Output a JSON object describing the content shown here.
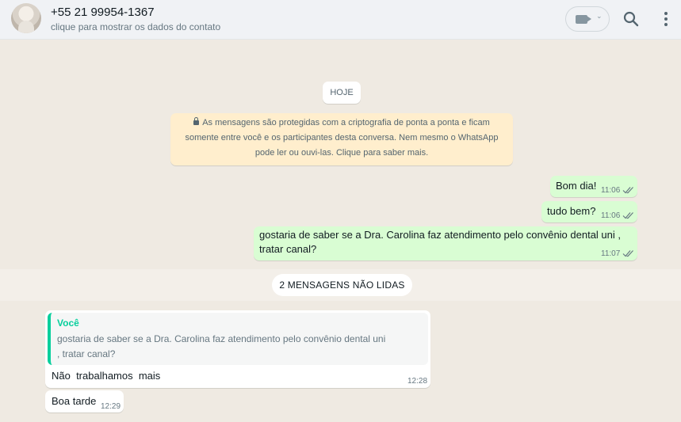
{
  "header": {
    "contact_phone": "+55 21 99954-1367",
    "contact_subtitle": "clique para mostrar os dados do contato",
    "icons": [
      "avatar",
      "video-call-icon",
      "chevron-down-icon",
      "search-icon",
      "menu-icon"
    ]
  },
  "chat": {
    "date_label": "HOJE",
    "encryption_notice": "As mensagens são protegidas com a criptografia de ponta a ponta e ficam somente entre você e os participantes desta conversa. Nem mesmo o WhatsApp pode ler ou ouvi-las. Clique para saber mais.",
    "encryption_lines": [
      "As mensagens são protegidas com a criptografia de ponta a ponta e ficam",
      "somente entre você e os participantes desta conversa. Nem mesmo o WhatsApp",
      "pode ler ou ouvi-las. Clique para saber mais."
    ],
    "outgoing": [
      {
        "text": "Bom dia!",
        "time": "11:06",
        "status": "delivered"
      },
      {
        "text": "tudo bem?",
        "time": "11:06",
        "status": "delivered"
      },
      {
        "text_lines": [
          "gostaria de saber se a Dra. Carolina faz atendimento pelo convênio dental uni ,",
          "tratar canal?"
        ],
        "time": "11:07",
        "status": "delivered"
      }
    ],
    "unread_label": "2 MENSAGENS NÃO LIDAS",
    "incoming": [
      {
        "quote_author": "Você",
        "quote_lines": [
          "gostaria de saber se a Dra. Carolina faz atendimento pelo convênio dental uni",
          ", tratar canal?"
        ],
        "text": "Não  trabalhamos  mais",
        "time": "12:28"
      },
      {
        "text": "Boa tarde",
        "time": "12:29"
      }
    ]
  },
  "colors": {
    "header_bg": "#f0f2f5",
    "chat_bg": "#efeae2",
    "outgoing_bubble": "#d9fdd3",
    "incoming_bubble": "#ffffff",
    "notice_bg": "#ffeecd",
    "quote_accent": "#06cf9c",
    "tick_color": "#667781"
  }
}
